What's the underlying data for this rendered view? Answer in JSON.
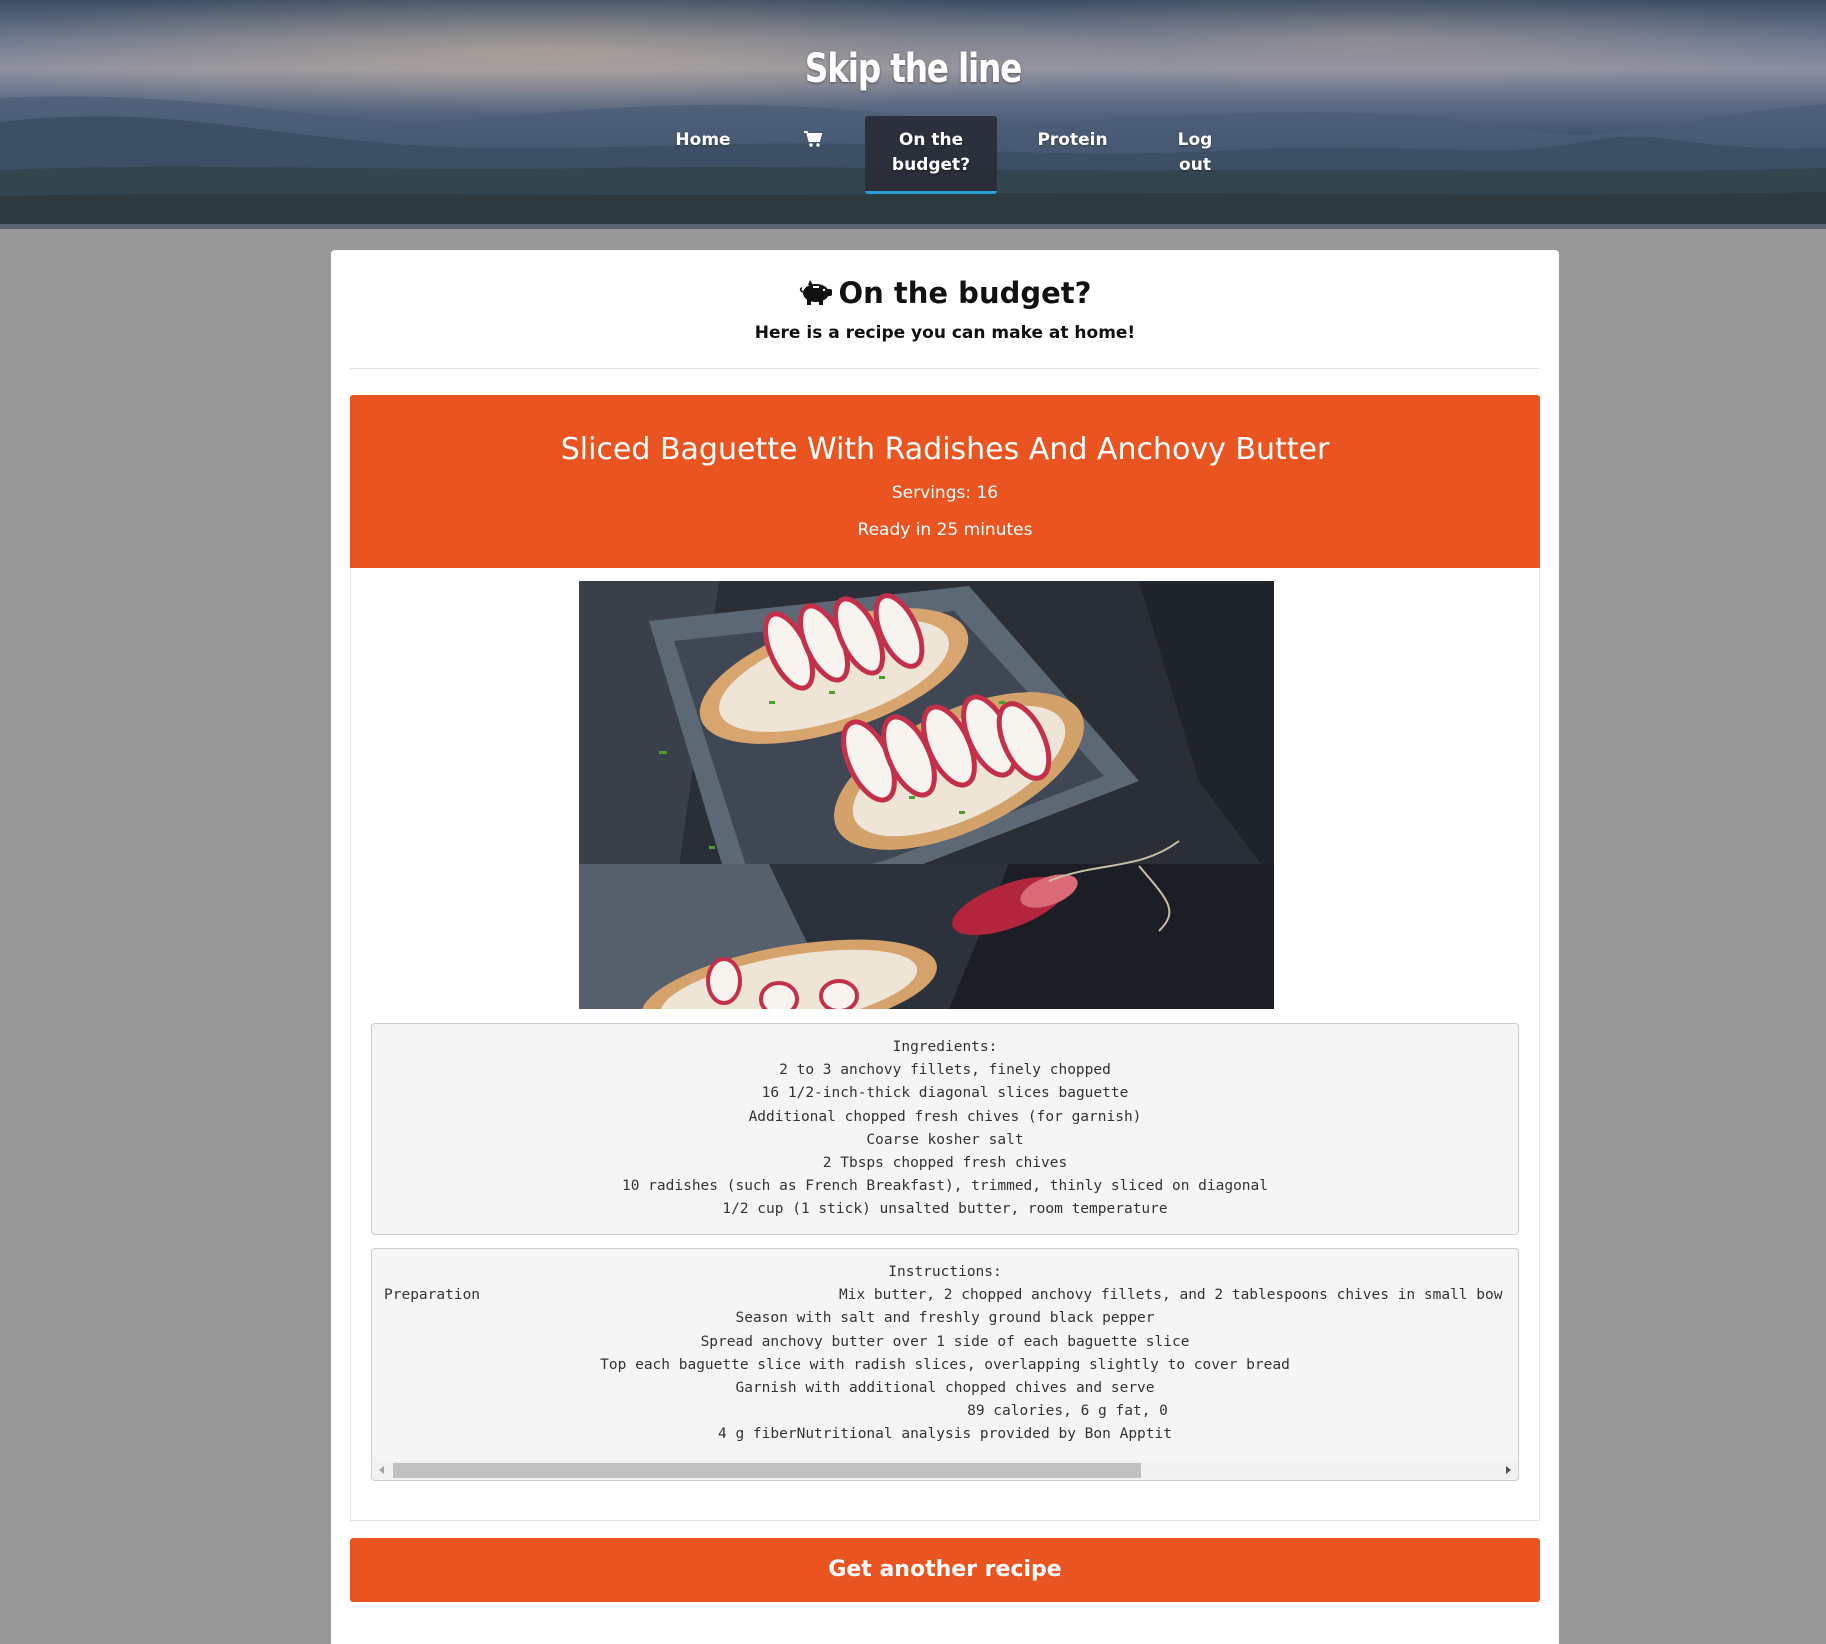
{
  "header": {
    "brand": "Skip the line",
    "nav": {
      "home": "Home",
      "cart_icon": "shopping-cart-icon",
      "budget_line1": "On the",
      "budget_line2": "budget?",
      "protein": "Protein",
      "logout_line1": "Log",
      "logout_line2": "out"
    },
    "active_tab": "On the budget?",
    "active_indicator_color": "#2a9fd6"
  },
  "page": {
    "title_icon": "piggy-bank-icon",
    "title": "On the budget?",
    "subtitle": "Here is a recipe you can make at home!"
  },
  "recipe": {
    "title": "Sliced Baguette With Radishes And Anchovy Butter",
    "servings": "Servings: 16",
    "ready": "Ready in 25 minutes",
    "accent_color": "#e95420",
    "ingredients_header": "Ingredients:",
    "ingredients": [
      "2 to 3 anchovy fillets, finely chopped",
      "16 1/2-inch-thick diagonal slices baguette",
      "Additional chopped fresh chives (for garnish)",
      "Coarse kosher salt",
      "2 Tbsps chopped fresh chives",
      "10 radishes (such as French Breakfast), trimmed, thinly sliced on diagonal",
      "1/2 cup (1 stick) unsalted butter, room temperature"
    ],
    "instructions_header": "Instructions:",
    "instructions_first_label": "Preparation",
    "instructions_first_text": "Mix butter, 2 chopped anchovy fillets, and 2 tablespoons chives in small bow",
    "instructions": [
      "Season with salt and freshly ground black pepper",
      "Spread anchovy butter over 1 side of each baguette slice",
      "Top each baguette slice with radish slices, overlapping slightly to cover bread",
      "Garnish with additional chopped chives and serve",
      "89 calories, 6 g fat, 0",
      "4 g fiberNutritional analysis provided by Bon Apptit"
    ]
  },
  "actions": {
    "another_recipe": "Get another recipe"
  }
}
